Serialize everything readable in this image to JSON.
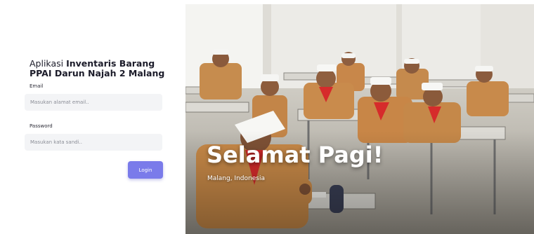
{
  "login": {
    "title_prefix": "Aplikasi ",
    "title_bold": "Inventaris Barang PPAI Darun Najah 2 Malang",
    "email_label": "Email",
    "email_placeholder": "Masukan alamat email..",
    "email_value": "",
    "password_label": "Password",
    "password_placeholder": "Masukan kata sandi..",
    "password_value": "",
    "login_button": "Login"
  },
  "hero": {
    "greeting": "Selamat Pagi!",
    "location": "Malang, Indonesia"
  },
  "colors": {
    "button": "#7a7bea",
    "input_bg": "#f3f4f6",
    "uniform": "#c9894a",
    "scarf": "#d62b2b"
  },
  "icons": []
}
